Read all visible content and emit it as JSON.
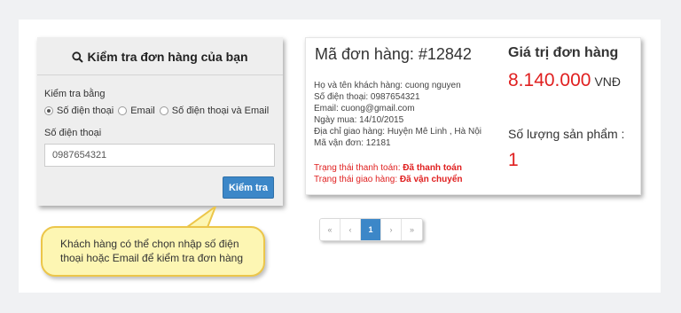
{
  "search": {
    "title": "Kiểm tra đơn hàng của bạn",
    "check_by_label": "Kiểm tra bằng",
    "options": [
      "Số điện thoại",
      "Email",
      "Số điện thoại và Email"
    ],
    "selected_option": "Số điện thoại",
    "phone_label": "Số điện thoại",
    "phone_value": "0987654321",
    "submit_label": "Kiểm tra"
  },
  "tooltip": {
    "line1": "Khách hàng có thể chọn nhập số điện",
    "line2": "thoại hoặc Email để kiểm tra đơn hàng"
  },
  "order": {
    "code": "Mã đơn hàng: #12842",
    "customer": "Họ và tên khách hàng: cuong nguyen",
    "phone": "Số điện thoại: 0987654321",
    "email": "Email: cuong@gmail.com",
    "date": "Ngày mua: 14/10/2015",
    "address": "Địa chỉ giao hàng: Huyện Mê Linh , Hà Nội",
    "tracking": "Mã vận đơn: 12181",
    "payment_label": "Trạng thái thanh toán: ",
    "payment_status": "Đã thanh toán",
    "shipping_label": "Trạng thái giao hàng: ",
    "shipping_status": "Đã vận chuyển",
    "value_title": "Giá trị đơn hàng",
    "value_amount": "8.140.000",
    "value_unit": "VNĐ",
    "qty_title": "Số lượng sản phẩm :",
    "qty_value": "1"
  },
  "pagination": {
    "first": "«",
    "prev": "‹",
    "current": "1",
    "next": "›",
    "last": "»"
  },
  "colors": {
    "accent": "#3c87c8",
    "danger": "#e02020",
    "bubble": "#fdf6b3"
  }
}
